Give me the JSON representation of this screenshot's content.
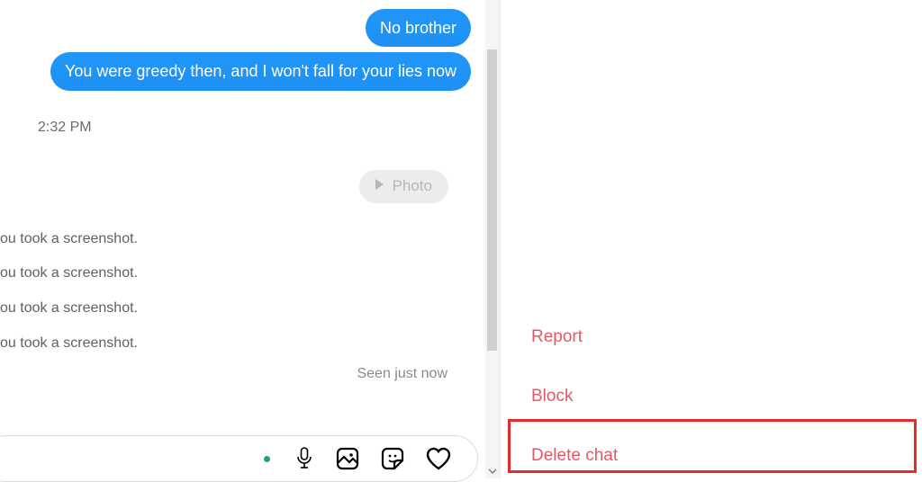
{
  "chat": {
    "messages": [
      {
        "text": "No brother"
      },
      {
        "text": "You were greedy then, and I won't fall for your lies now"
      }
    ],
    "timestamp": "2:32 PM",
    "photo_chip_label": "Photo",
    "system_events": [
      "ou took a screenshot.",
      "ou took a screenshot.",
      "ou took a screenshot.",
      "ou took a screenshot."
    ],
    "seen_label": "Seen just now"
  },
  "right_panel": {
    "actions": {
      "report": "Report",
      "block": "Block",
      "delete": "Delete chat"
    }
  }
}
